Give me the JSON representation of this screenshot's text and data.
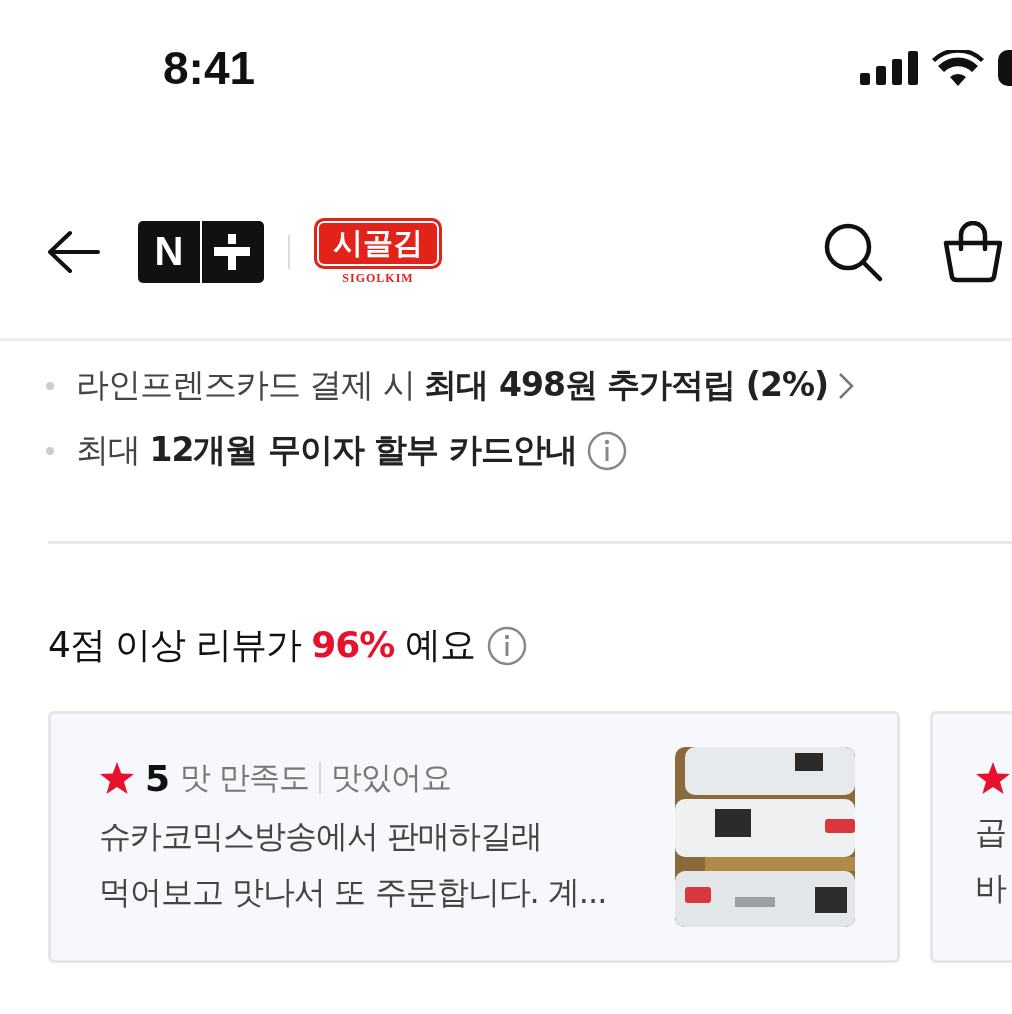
{
  "status_bar": {
    "time": "8:41"
  },
  "header": {
    "brand_badge": {
      "letter": "N"
    },
    "store_logo": {
      "name": "시골김",
      "romanized": "SIGOLKIM"
    }
  },
  "benefits": [
    {
      "text": "라인프렌즈카드 결제 시 **최대 498원 추가적립 (2%)**",
      "kind": "link"
    },
    {
      "text": "최대 **12개월 무이자 할부 카드안내**",
      "kind": "info"
    }
  ],
  "review_summary": {
    "prefix": "4점 이상 리뷰가 ",
    "highlight": "96%",
    "suffix": " 예요"
  },
  "reviews": [
    {
      "rating": "5",
      "aspect": "맛 만족도",
      "answer": "맛있어요",
      "lines": [
        "슈카코믹스방송에서 판매하길래",
        "먹어보고 맛나서 또 주문합니다. 계..."
      ]
    },
    {
      "lines": [
        "곱",
        "바"
      ]
    }
  ]
}
